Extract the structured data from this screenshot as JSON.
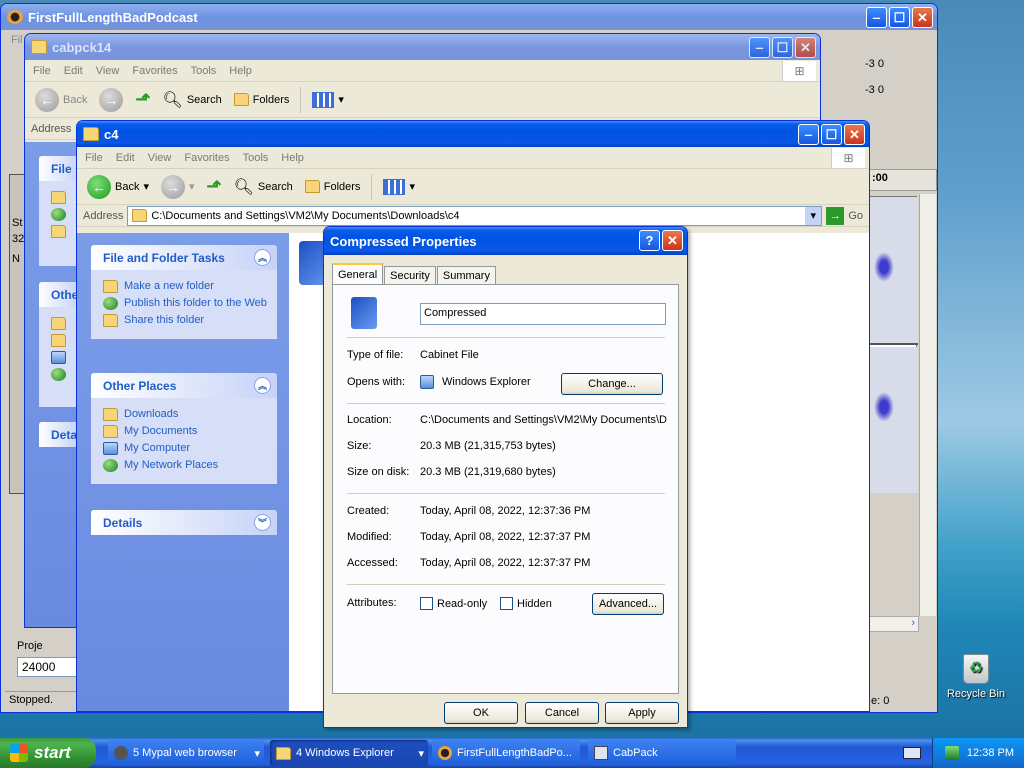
{
  "audacity": {
    "title": "FirstFullLengthBadPodcast",
    "menu_fragment": "Fil",
    "ruler_text": "-3  0",
    "left_fragments": [
      "St",
      "32",
      "N"
    ],
    "rate_label": "Proje",
    "rate_value": "24000",
    "status": "Stopped.",
    "status_right": "e: 0",
    "time_ruler": ":00"
  },
  "win1": {
    "title": "cabpck14",
    "menu": [
      "File",
      "Edit",
      "View",
      "Favorites",
      "Tools",
      "Help"
    ],
    "back": "Back",
    "search": "Search",
    "folders": "Folders",
    "address_label": "Address",
    "panel_fragments": [
      "File",
      "Othe",
      "Deta"
    ]
  },
  "win2": {
    "title": "c4",
    "menu": [
      "File",
      "Edit",
      "View",
      "Favorites",
      "Tools",
      "Help"
    ],
    "back": "Back",
    "search": "Search",
    "folders": "Folders",
    "address_label": "Address",
    "address_value": "C:\\Documents and Settings\\VM2\\My Documents\\Downloads\\c4",
    "go": "Go",
    "tasks": {
      "title": "File and Folder Tasks",
      "items": [
        "Make a new folder",
        "Publish this folder to the Web",
        "Share this folder"
      ]
    },
    "places": {
      "title": "Other Places",
      "items": [
        "Downloads",
        "My Documents",
        "My Computer",
        "My Network Places"
      ]
    },
    "details": {
      "title": "Details"
    }
  },
  "dialog": {
    "title": "Compressed Properties",
    "tabs": [
      "General",
      "Security",
      "Summary"
    ],
    "name": "Compressed",
    "type_label": "Type of file:",
    "type_value": "Cabinet File",
    "opens_label": "Opens with:",
    "opens_value": "Windows Explorer",
    "change": "Change...",
    "location_label": "Location:",
    "location_value": "C:\\Documents and Settings\\VM2\\My Documents\\D",
    "size_label": "Size:",
    "size_value": "20.3 MB (21,315,753 bytes)",
    "disk_label": "Size on disk:",
    "disk_value": "20.3 MB (21,319,680 bytes)",
    "created_label": "Created:",
    "created_value": "Today, April 08, 2022, 12:37:36 PM",
    "modified_label": "Modified:",
    "modified_value": "Today, April 08, 2022, 12:37:37 PM",
    "accessed_label": "Accessed:",
    "accessed_value": "Today, April 08, 2022, 12:37:37 PM",
    "attr_label": "Attributes:",
    "readonly": "Read-only",
    "hidden": "Hidden",
    "advanced": "Advanced...",
    "ok": "OK",
    "cancel": "Cancel",
    "apply": "Apply"
  },
  "desktop": {
    "recycle": "Recycle Bin"
  },
  "taskbar": {
    "start": "start",
    "buttons": [
      "5 Mypal web browser",
      "4 Windows Explorer",
      "FirstFullLengthBadPo...",
      "CabPack"
    ],
    "clock": "12:38 PM"
  },
  "colors": {
    "xp_blue": "#0054e3",
    "pane_blue": "#6a8ae0",
    "link_blue": "#215dc6",
    "taskbar": "#2157d7",
    "start_green": "#3c9a3c"
  }
}
